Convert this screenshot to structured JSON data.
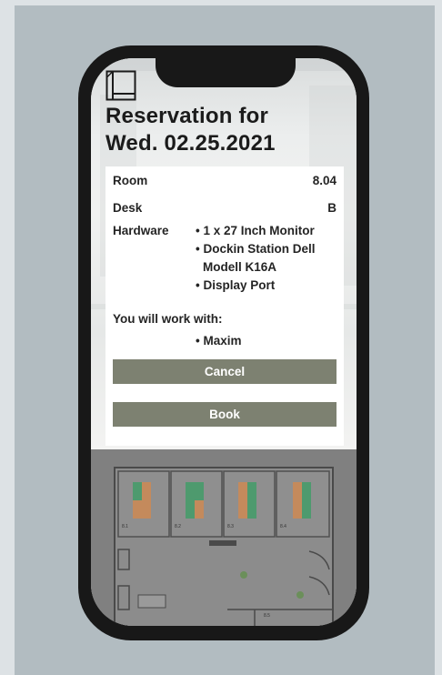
{
  "reservation": {
    "title_line1": "Reservation for",
    "title_line2": "Wed. 02.25.2021",
    "room_label": "Room",
    "room_value": "8.04",
    "desk_label": "Desk",
    "desk_value": "B",
    "hardware_label": "Hardware",
    "hardware_items": [
      "• 1 x 27 Inch Monitor",
      "• Dockin Station Dell",
      "Modell K16A",
      "• Display Port"
    ],
    "coworkers_label": "You will work with:",
    "coworkers": [
      "• Maxim"
    ],
    "cancel_label": "Cancel",
    "book_label": "Book"
  },
  "floorplan": {
    "room_labels": [
      "8.1",
      "8.2",
      "8.3",
      "8.4",
      "8.5"
    ]
  },
  "colors": {
    "button": "#7d8171",
    "desk_green": "#4e9a6e",
    "desk_orange": "#c48a5c"
  },
  "icons": {
    "logo": "building-outline-icon"
  }
}
